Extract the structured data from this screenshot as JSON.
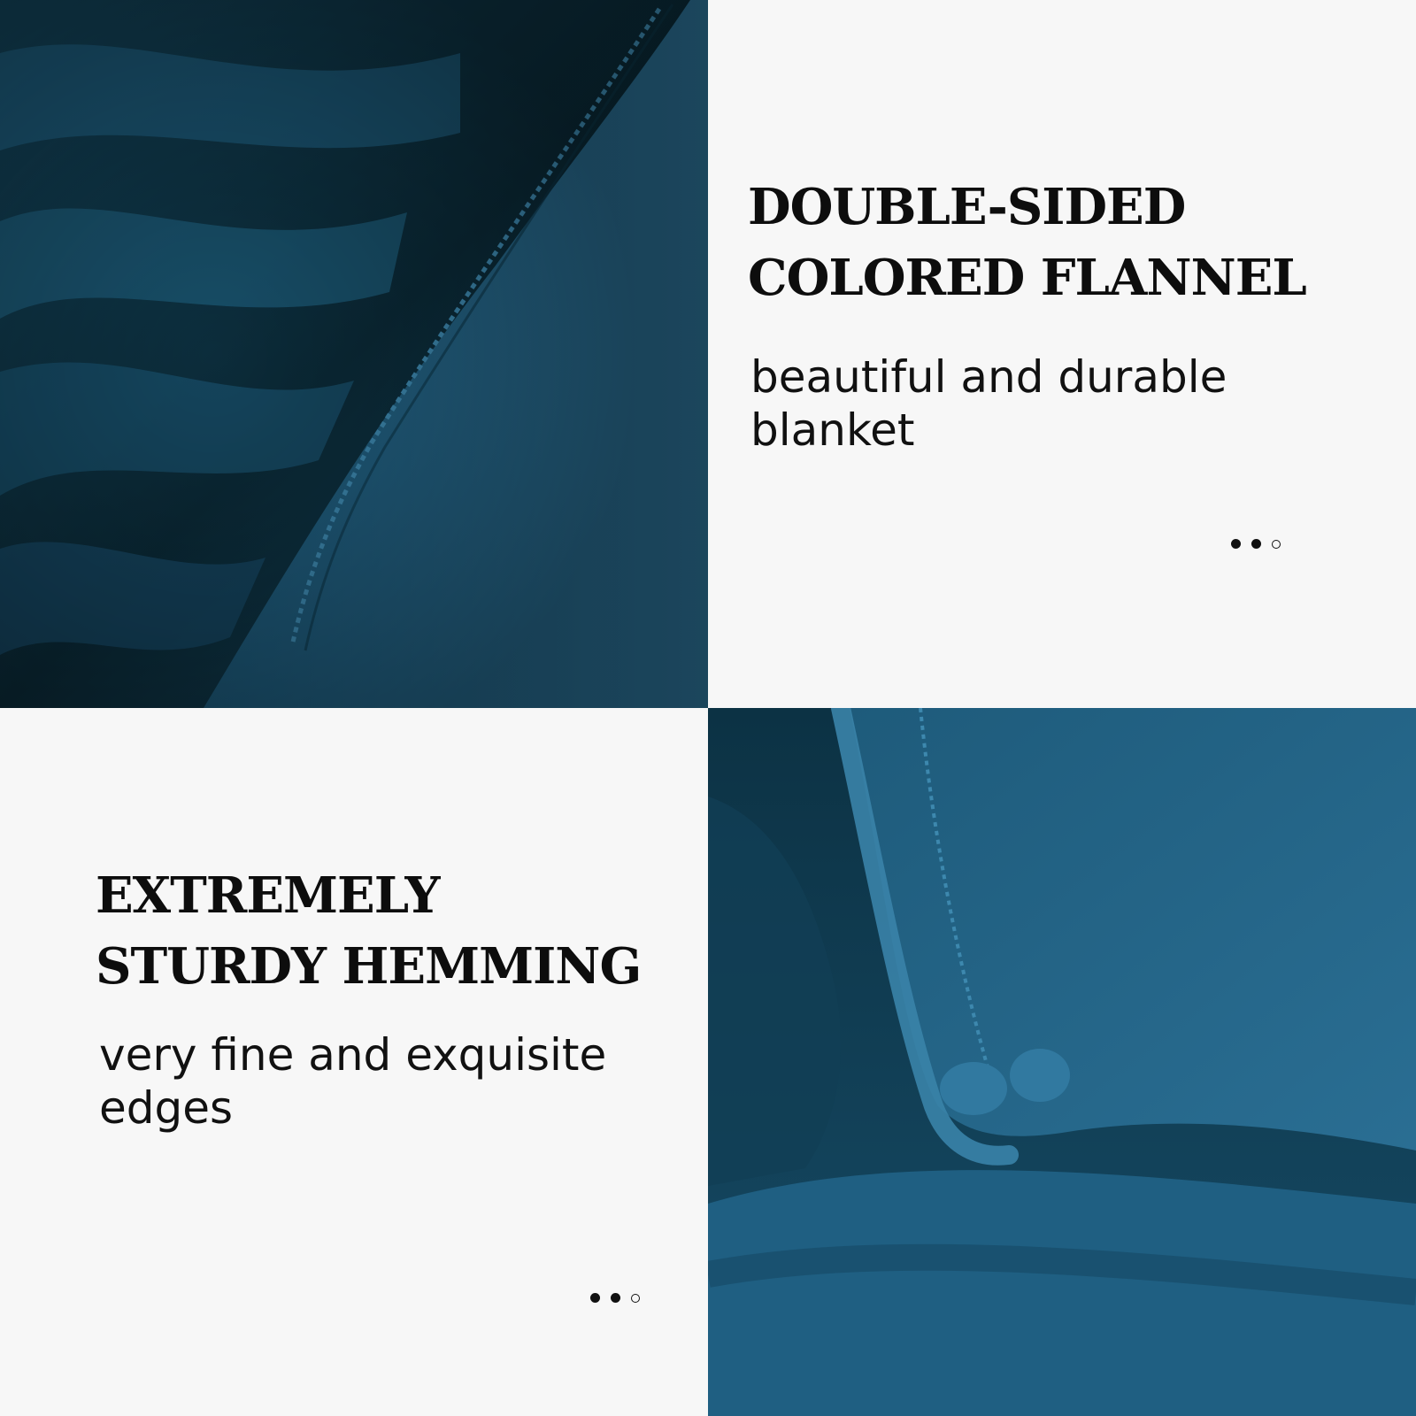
{
  "colors": {
    "fabric_dark": "#0b2f3e",
    "fabric_mid": "#1d5775",
    "fabric_light": "#2f7599",
    "background": "#f7f7f7",
    "text": "#0d0d0d"
  },
  "panels": [
    {
      "heading_lines": [
        "DOUBLE-SIDED",
        "COLORED FLANNEL"
      ],
      "subtext_lines": [
        "beautiful and durable",
        "blanket"
      ],
      "dots": [
        "filled",
        "filled",
        "empty"
      ]
    },
    {
      "heading_lines": [
        "EXTREMELY",
        "STURDY HEMMING"
      ],
      "subtext_lines": [
        "very fine and exquisite",
        "edges"
      ],
      "dots": [
        "filled",
        "filled",
        "empty"
      ]
    }
  ],
  "photos": [
    {
      "subject": "folded teal flannel blanket with stitched hem"
    },
    {
      "subject": "teal flannel blanket corner with hemmed edge"
    }
  ]
}
